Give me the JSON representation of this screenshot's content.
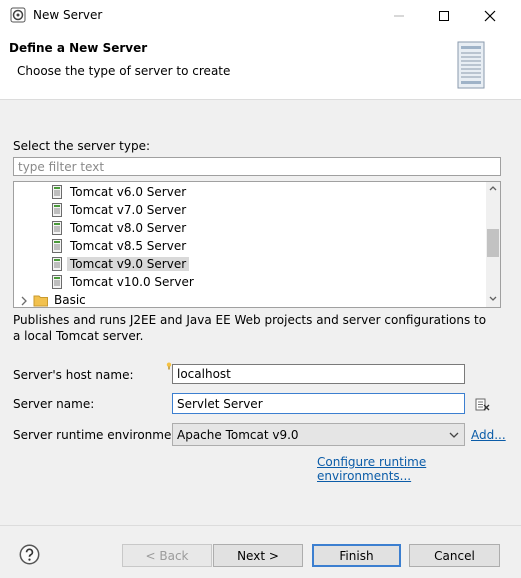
{
  "window": {
    "title": "New Server",
    "controls": [
      "minimize",
      "maximize",
      "close"
    ]
  },
  "banner": {
    "title": "Define a New Server",
    "description": "Choose the type of server to create",
    "graphic_icon": "server-tower-icon"
  },
  "server_type": {
    "label": "Select the server type:",
    "filter_placeholder": "type filter text",
    "tree_items": [
      {
        "label": "Tomcat v6.0 Server",
        "icon": "tomcat-server-icon",
        "selected": false
      },
      {
        "label": "Tomcat v7.0 Server",
        "icon": "tomcat-server-icon",
        "selected": false
      },
      {
        "label": "Tomcat v8.0 Server",
        "icon": "tomcat-server-icon",
        "selected": false
      },
      {
        "label": "Tomcat v8.5 Server",
        "icon": "tomcat-server-icon",
        "selected": false
      },
      {
        "label": "Tomcat v9.0 Server",
        "icon": "tomcat-server-icon",
        "selected": true
      },
      {
        "label": "Tomcat v10.0 Server",
        "icon": "tomcat-server-icon",
        "selected": false
      }
    ],
    "folder_item": {
      "label": "Basic",
      "icon": "folder-icon",
      "expanded": false
    },
    "description": "Publishes and runs J2EE and Java EE Web projects and server configurations to a local Tomcat server."
  },
  "form": {
    "host_label": "Server's host name:",
    "host_value": "localhost",
    "name_label": "Server name:",
    "name_value": "Servlet Server",
    "runtime_label": "Server runtime environment:",
    "runtime_value": "Apache Tomcat v9.0",
    "add_link": "Add...",
    "configure_link": "Configure runtime environments..."
  },
  "buttons": {
    "help_icon": "help-icon",
    "back": "< Back",
    "next": "Next >",
    "finish": "Finish",
    "cancel": "Cancel"
  },
  "colors": {
    "accent": "#3c7fd0",
    "link": "#0b5ca8",
    "selection": "#d9d9d9"
  }
}
